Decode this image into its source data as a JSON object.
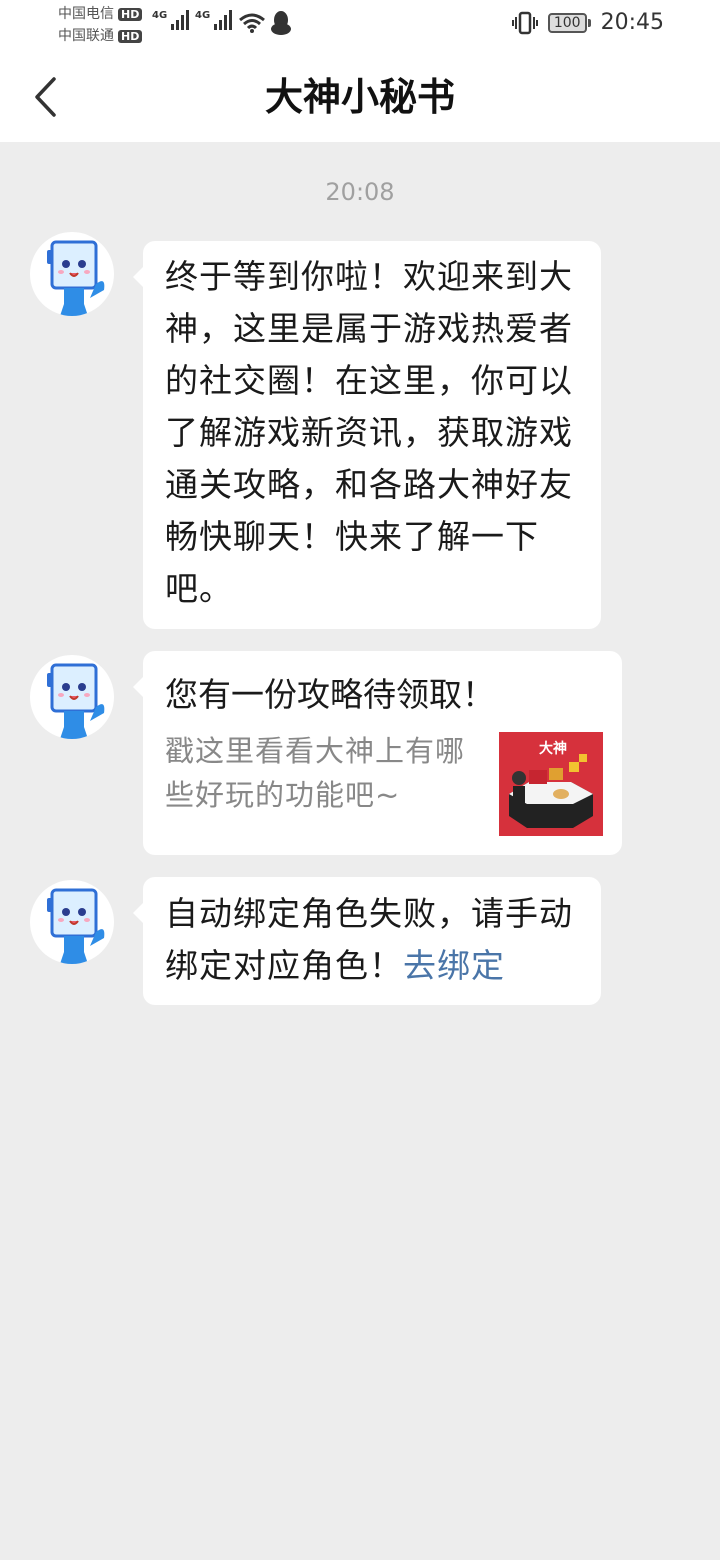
{
  "status_bar": {
    "carrier_1": "中国电信",
    "carrier_2": "中国联通",
    "hd_badge": "HD",
    "network_type": "4G",
    "battery_level": "100",
    "time": "20:45"
  },
  "header": {
    "title": "大神小秘书"
  },
  "chat": {
    "timestamp": "20:08",
    "messages": [
      {
        "text": "终于等到你啦！欢迎来到大神，这里是属于游戏热爱者的社交圈！在这里，你可以了解游戏新资讯，获取游戏通关攻略，和各路大神好友畅快聊天！快来了解一下吧。"
      },
      {
        "card_title": "您有一份攻略待领取！",
        "card_desc": "戳这里看看大神上有哪些好玩的功能吧~",
        "thumbnail_logo": "大神"
      },
      {
        "text": "自动绑定角色失败，请手动绑定对应角色！",
        "link_text": "去绑定"
      }
    ]
  },
  "colors": {
    "background": "#ededed",
    "bubble": "#ffffff",
    "link": "#4a75a8",
    "thumbnail_bg": "#d6313c"
  }
}
